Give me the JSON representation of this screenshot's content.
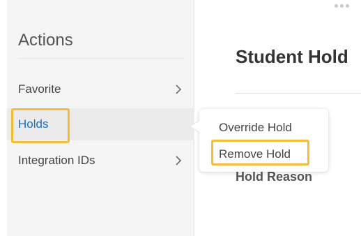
{
  "actions": {
    "title": "Actions",
    "items": [
      {
        "label": "Favorite",
        "has_submenu": true,
        "icon": "chevron-right-icon"
      },
      {
        "label": "Holds",
        "has_submenu": false,
        "active": true
      },
      {
        "label": "Integration IDs",
        "has_submenu": true,
        "icon": "chevron-right-icon"
      }
    ]
  },
  "main": {
    "title": "Student Hold",
    "field_label": "Hold Reason"
  },
  "popover": {
    "items": [
      {
        "label": "Override Hold"
      },
      {
        "label": "Remove Hold",
        "highlighted": true
      }
    ]
  },
  "header": {
    "more_icon": "more-dots-icon"
  },
  "colors": {
    "highlight": "#f2bd3b",
    "active_link": "#1a6fbd",
    "panel_bg": "#f5f5f5"
  }
}
